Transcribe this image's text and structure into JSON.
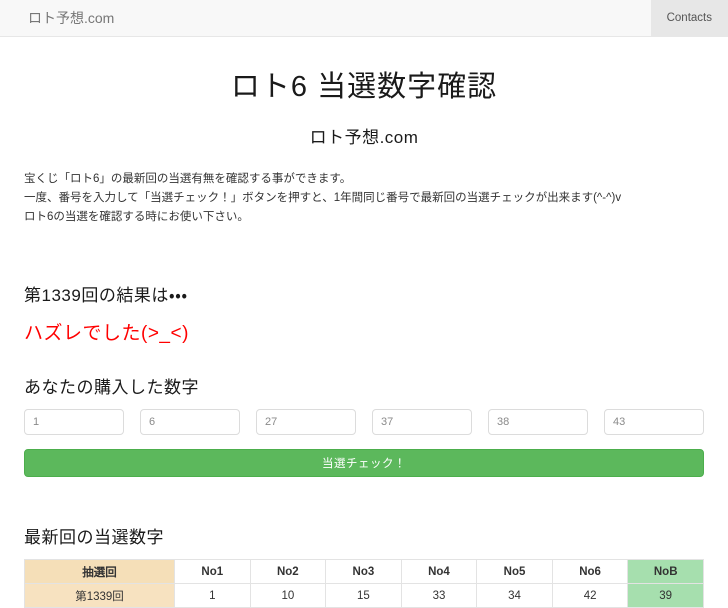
{
  "navbar": {
    "brand": "ロト予想.com",
    "links": [
      {
        "label": "Contacts",
        "name": "nav-link-contacts",
        "active": true
      }
    ]
  },
  "header": {
    "title": "ロト6 当選数字確認",
    "subtitle": "ロト予想.com"
  },
  "description": {
    "line1": "宝くじ「ロト6」の最新回の当選有無を確認する事ができます。",
    "line2": "一度、番号を入力して「当選チェック！」ボタンを押すと、1年間同じ番号で最新回の当選チェックが出来ます(^-^)v",
    "line3": "ロト6の当選を確認する時にお使い下さい。"
  },
  "result": {
    "round_label": "第1339回の結果は・・・",
    "verdict": "ハズレでした(>_<)",
    "verdict_color": "#ff0000"
  },
  "form": {
    "heading": "あなたの購入した数字",
    "inputs": [
      {
        "value": "1",
        "placeholder": "1"
      },
      {
        "value": "6",
        "placeholder": "6"
      },
      {
        "value": "27",
        "placeholder": "27"
      },
      {
        "value": "37",
        "placeholder": "37"
      },
      {
        "value": "38",
        "placeholder": "38"
      },
      {
        "value": "43",
        "placeholder": "43"
      }
    ],
    "submit_label": "当選チェック！",
    "submit_color": "#5cb85c"
  },
  "latest": {
    "heading": "最新回の当選数字",
    "columns": [
      "抽選回",
      "No1",
      "No2",
      "No3",
      "No4",
      "No5",
      "No6",
      "NoB"
    ],
    "row": [
      "第1339回",
      "1",
      "10",
      "15",
      "33",
      "34",
      "42",
      "39"
    ],
    "round_header_color": "#f5dfb8",
    "round_cell_color": "#f7e2c0",
    "bonus_color": "#a6dfae"
  }
}
